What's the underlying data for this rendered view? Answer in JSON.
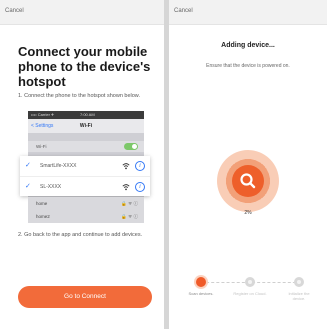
{
  "left_screen": {
    "cancel_label": "Cancel",
    "title": "Connect your mobile phone to the device's hotspot",
    "step1": "1. Connect the phone to the hotspot shown below.",
    "phone": {
      "status_left": "•••• Carrier ✈",
      "status_center": "7:00 AM",
      "back_label": "< Settings",
      "nav_title": "Wi-Fi",
      "wifi_toggle_label": "Wi-Fi",
      "networks": [
        {
          "name": "SmartLife-XXXX"
        },
        {
          "name": "SL-XXXX"
        }
      ],
      "other_networks": [
        {
          "name": "home"
        },
        {
          "name": "home2"
        }
      ]
    },
    "step2": "2. Go back to the app and continue to add devices.",
    "connect_button": "Go to Connect"
  },
  "right_screen": {
    "cancel_label": "Cancel",
    "title": "Adding device...",
    "subtitle": "Ensure that the device is powered on.",
    "progress_percent": "2%",
    "steps": [
      {
        "label": "Scan devices.",
        "state": "active"
      },
      {
        "label": "Register on Cloud.",
        "state": "pending"
      },
      {
        "label": "Initialize the device.",
        "state": "pending"
      }
    ]
  },
  "colors": {
    "accent": "#f05a28",
    "ios_blue": "#3478f6",
    "toggle_green": "#7dc86a"
  }
}
